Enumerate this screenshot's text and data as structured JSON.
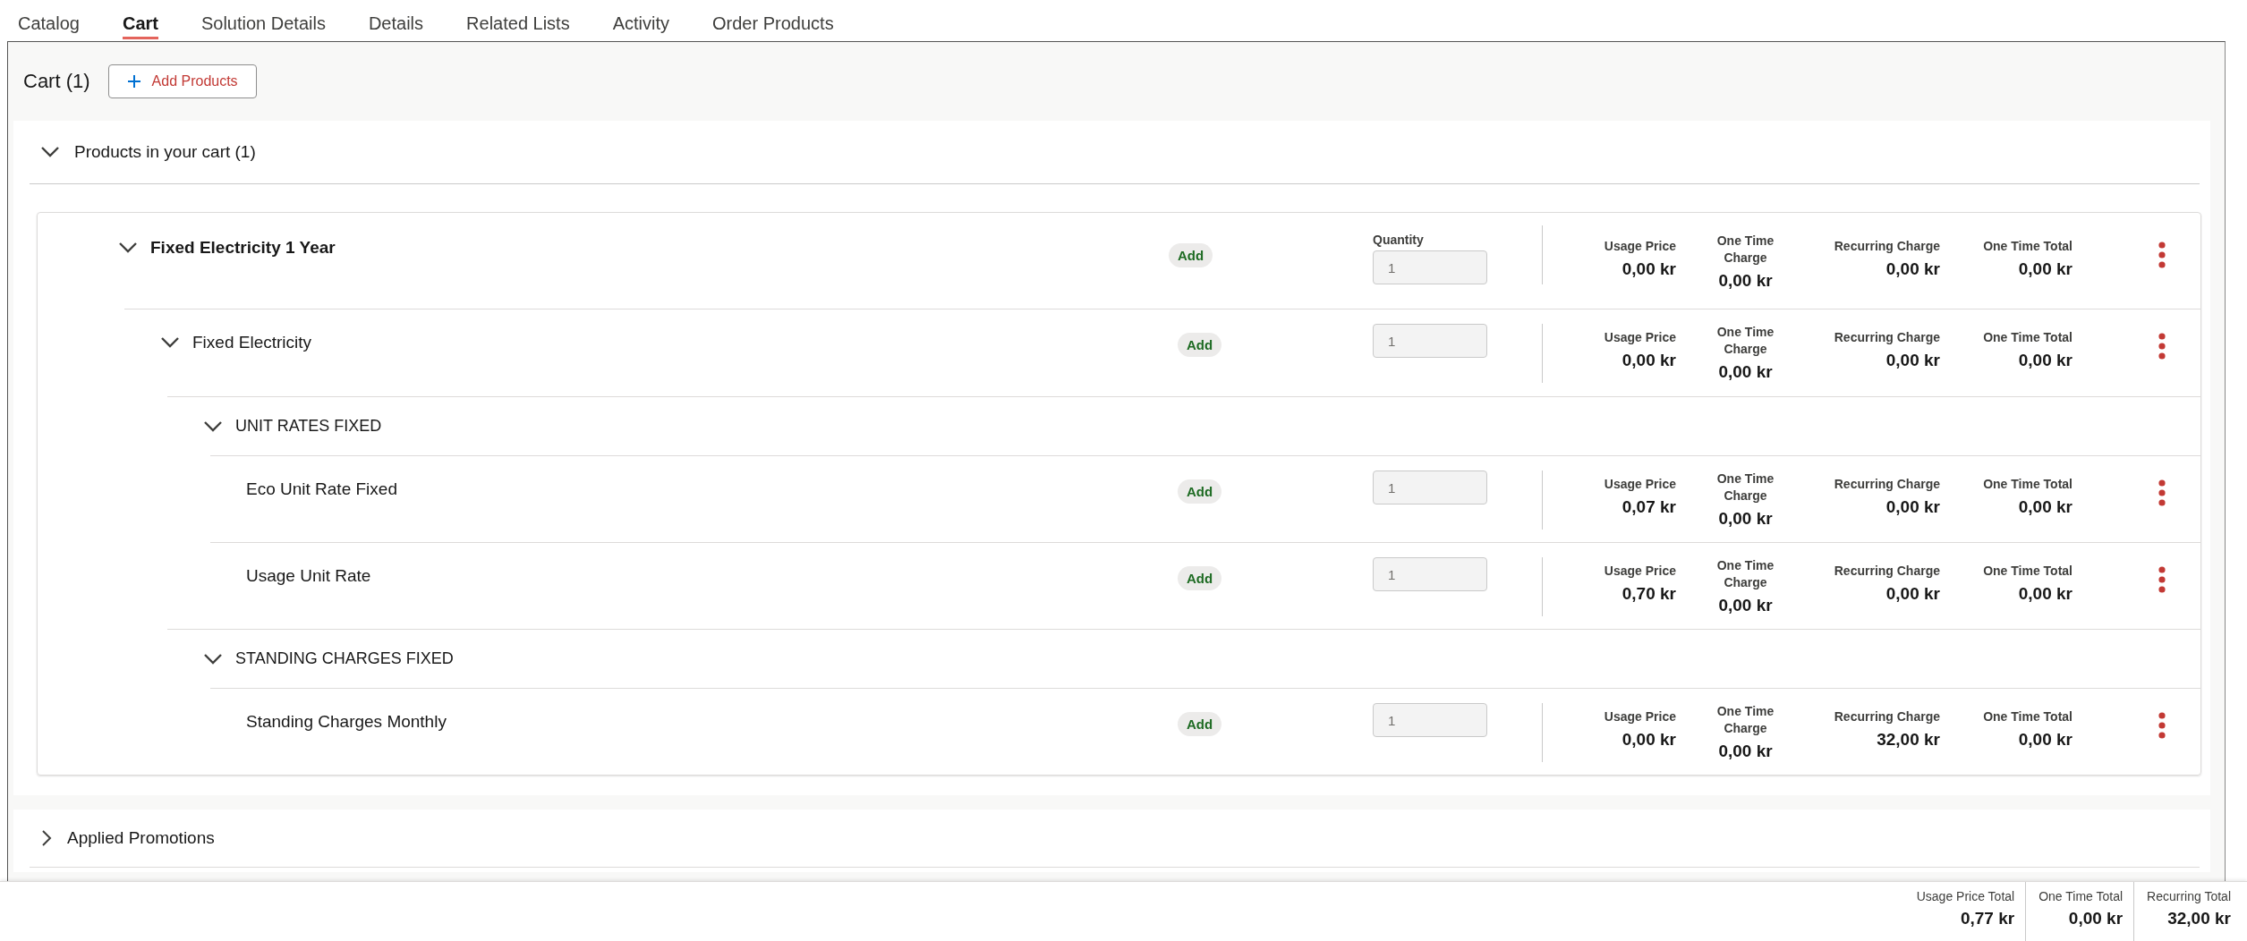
{
  "tabs": [
    {
      "label": "Catalog",
      "selected": false
    },
    {
      "label": "Cart",
      "selected": true
    },
    {
      "label": "Solution Details",
      "selected": false
    },
    {
      "label": "Details",
      "selected": false
    },
    {
      "label": "Related Lists",
      "selected": false
    },
    {
      "label": "Activity",
      "selected": false
    },
    {
      "label": "Order Products",
      "selected": false
    }
  ],
  "cart_header": {
    "title": "Cart (1)",
    "add_button": "Add Products"
  },
  "products_section": {
    "title": "Products in your cart (1)",
    "expanded": true,
    "items": [
      {
        "kind": "product",
        "name": "Fixed Electricity 1 Year",
        "expanded": true,
        "status": "Add",
        "quantity_label": "Quantity",
        "quantity": "1",
        "prices": [
          {
            "label": "Usage Price",
            "value": "0,00 kr"
          },
          {
            "label": "One Time Charge",
            "value": "0,00 kr"
          },
          {
            "label": "Recurring Charge",
            "value": "0,00 kr"
          },
          {
            "label": "One Time Total",
            "value": "0,00 kr"
          }
        ],
        "children": [
          {
            "kind": "product",
            "name": "Fixed Electricity",
            "expanded": true,
            "status": "Add",
            "quantity": "1",
            "prices": [
              {
                "label": "Usage Price",
                "value": "0,00 kr"
              },
              {
                "label": "One Time Charge",
                "value": "0,00 kr"
              },
              {
                "label": "Recurring Charge",
                "value": "0,00 kr"
              },
              {
                "label": "One Time Total",
                "value": "0,00 kr"
              }
            ],
            "children": [
              {
                "kind": "group",
                "name": "UNIT RATES FIXED",
                "expanded": true,
                "children": [
                  {
                    "kind": "product",
                    "name": "Eco Unit Rate Fixed",
                    "status": "Add",
                    "quantity": "1",
                    "prices": [
                      {
                        "label": "Usage Price",
                        "value": "0,07 kr"
                      },
                      {
                        "label": "One Time Charge",
                        "value": "0,00 kr"
                      },
                      {
                        "label": "Recurring Charge",
                        "value": "0,00 kr"
                      },
                      {
                        "label": "One Time Total",
                        "value": "0,00 kr"
                      }
                    ]
                  },
                  {
                    "kind": "product",
                    "name": "Usage Unit Rate",
                    "status": "Add",
                    "quantity": "1",
                    "prices": [
                      {
                        "label": "Usage Price",
                        "value": "0,70 kr"
                      },
                      {
                        "label": "One Time Charge",
                        "value": "0,00 kr"
                      },
                      {
                        "label": "Recurring Charge",
                        "value": "0,00 kr"
                      },
                      {
                        "label": "One Time Total",
                        "value": "0,00 kr"
                      }
                    ]
                  }
                ]
              },
              {
                "kind": "group",
                "name": "STANDING CHARGES FIXED",
                "expanded": true,
                "children": [
                  {
                    "kind": "product",
                    "name": "Standing Charges Monthly",
                    "status": "Add",
                    "quantity": "1",
                    "prices": [
                      {
                        "label": "Usage Price",
                        "value": "0,00 kr"
                      },
                      {
                        "label": "One Time Charge",
                        "value": "0,00 kr"
                      },
                      {
                        "label": "Recurring Charge",
                        "value": "32,00 kr"
                      },
                      {
                        "label": "One Time Total",
                        "value": "0,00 kr"
                      }
                    ]
                  }
                ]
              }
            ]
          }
        ]
      }
    ]
  },
  "promotions_section": {
    "title": "Applied Promotions",
    "expanded": false
  },
  "totals": [
    {
      "label": "Usage Price Total",
      "value": "0,77 kr"
    },
    {
      "label": "One Time Total",
      "value": "0,00 kr"
    },
    {
      "label": "Recurring Total",
      "value": "32,00 kr"
    }
  ]
}
